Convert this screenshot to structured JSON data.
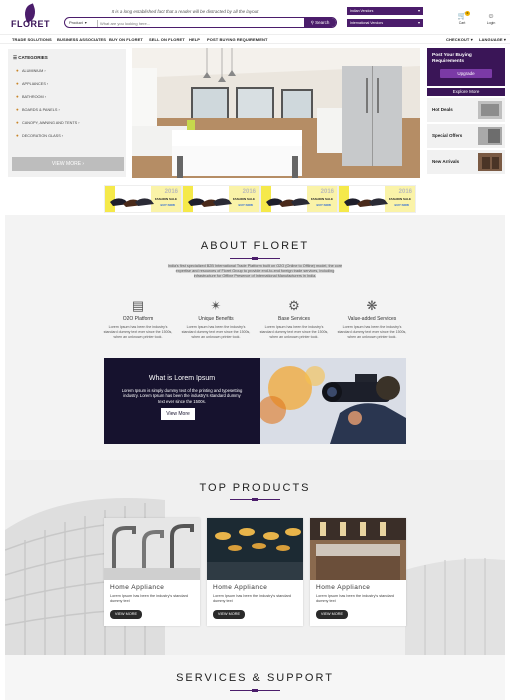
{
  "brand": {
    "name": "FLORET",
    "accent": "#4b1d6b"
  },
  "header": {
    "tagline": "It is a long established fact that a reader will be distracted by all the layout",
    "search": {
      "category": "Product",
      "placeholder": "What are you looking here...",
      "button": "Search"
    },
    "vendor_buttons": [
      "Indian Vendors",
      "International Vendors"
    ],
    "cart": {
      "label": "Cart",
      "count": "0"
    },
    "login": {
      "label": "Login"
    }
  },
  "nav": {
    "left": [
      "TRADE SOLUTIONS",
      "BUSINESS ASSOCIATES",
      "BUY ON FLORET",
      "SELL ON FLORET",
      "HELP",
      "POST BUYING REQUIREMENT"
    ],
    "right": [
      "CHECKOUT",
      "LANGUAGE"
    ]
  },
  "categories": {
    "title": "CATEGORIES",
    "items": [
      "ALUMINIUM",
      "APPLIANCES",
      "BATHROOM",
      "BOARDS & PANELS",
      "CANOPY, AWNING AND TENTS",
      "DECORATION GLASS"
    ],
    "view_more": "VIEW MORE"
  },
  "right_panel": {
    "post_title": "Post Your Buying Requirements",
    "upgrade": "Upgrade",
    "explore": "Explore More",
    "items": [
      "Hot Deals",
      "Special Offers",
      "New Arrivals"
    ]
  },
  "promos": [
    {
      "year": "2016",
      "title": "FASHION SALE",
      "cta": "BUY NOW"
    },
    {
      "year": "2016",
      "title": "FASHION SALE",
      "cta": "BUY NOW"
    },
    {
      "year": "2016",
      "title": "FASHION SALE",
      "cta": "BUY NOW"
    },
    {
      "year": "2016",
      "title": "FASHION SALE",
      "cta": "BUY NOW"
    }
  ],
  "about": {
    "title": "ABOUT FLORET",
    "text": "India's first specialized B2B International Trade Platform built on O2O (Online to Offline) model, the core expertise and resources of Floret Group to provide end-to-end foreign trade services, including infrastructure for Offline Presence of International Manufacturers in India.",
    "features": [
      {
        "icon": "platform-icon",
        "title": "O2O Platform",
        "desc": "Lorem Ipsum has been the industry's standard dummy text ever since the 1500s, when an unknown printer took."
      },
      {
        "icon": "benefits-icon",
        "title": "Unique Benefits",
        "desc": "Lorem Ipsum has been the industry's standard dummy text ever since the 1500s, when an unknown printer took."
      },
      {
        "icon": "gears-icon",
        "title": "Base Services",
        "desc": "Lorem Ipsum has been the industry's standard dummy text ever since the 1500s, when an unknown printer took."
      },
      {
        "icon": "network-icon",
        "title": "Value-added Services",
        "desc": "Lorem Ipsum has been the industry's standard dummy text ever since the 1500s, when an unknown printer took."
      }
    ]
  },
  "banner": {
    "title": "What is Lorem Ipsum",
    "text": "Lorem Ipsum is simply dummy text of the printing and typesetting industry. Lorem Ipsum has been the industry's standard dummy text ever since the 1500s.",
    "button": "View More"
  },
  "top_products": {
    "title": "TOP PRODUCTS",
    "items": [
      {
        "title": "Home Appliance",
        "desc": "Lorem Ipsum has been the industry's standard dummy text",
        "button": "VIEW MORE"
      },
      {
        "title": "Home Appliance",
        "desc": "Lorem Ipsum has been the industry's standard dummy text",
        "button": "VIEW MORE"
      },
      {
        "title": "Home Appliance",
        "desc": "Lorem Ipsum has been the industry's standard dummy text",
        "button": "VIEW MORE"
      }
    ]
  },
  "services": {
    "title": "SERVICES & SUPPORT"
  }
}
